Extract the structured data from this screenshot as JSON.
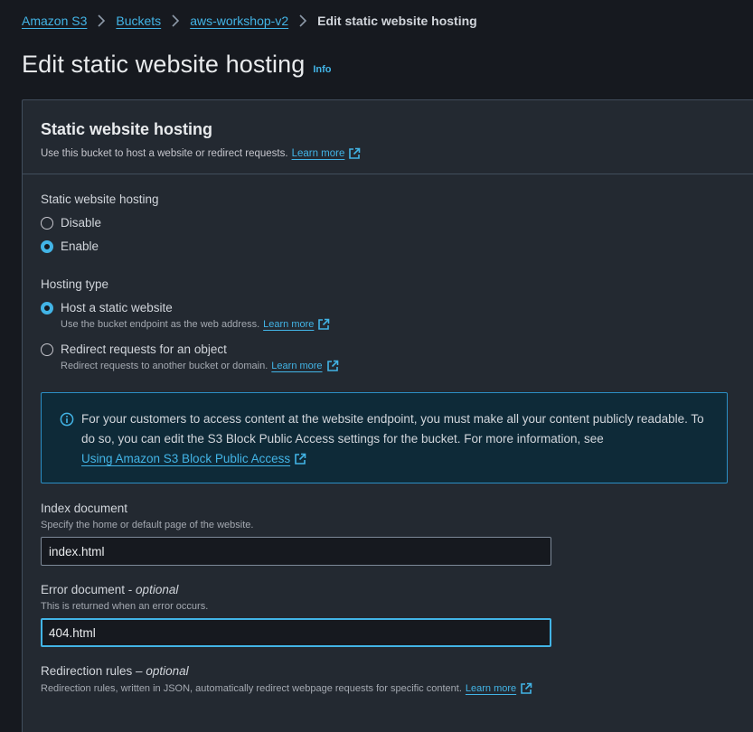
{
  "breadcrumb": {
    "items": [
      "Amazon S3",
      "Buckets",
      "aws-workshop-v2"
    ],
    "current": "Edit static website hosting"
  },
  "page": {
    "title": "Edit static website hosting",
    "info_label": "Info"
  },
  "panel": {
    "title": "Static website hosting",
    "description": "Use this bucket to host a website or redirect requests.",
    "learn_more": "Learn more"
  },
  "hosting": {
    "label": "Static website hosting",
    "options": [
      "Disable",
      "Enable"
    ],
    "selected": "Enable"
  },
  "hosting_type": {
    "label": "Hosting type",
    "options": [
      {
        "label": "Host a static website",
        "hint": "Use the bucket endpoint as the web address.",
        "link": "Learn more"
      },
      {
        "label": "Redirect requests for an object",
        "hint": "Redirect requests to another bucket or domain.",
        "link": "Learn more"
      }
    ],
    "selected": "Host a static website"
  },
  "alert": {
    "text": "For your customers to access content at the website endpoint, you must make all your content publicly readable. To do so, you can edit the S3 Block Public Access settings for the bucket. For more information, see",
    "link": "Using Amazon S3 Block Public Access"
  },
  "index_document": {
    "label": "Index document",
    "hint": "Specify the home or default page of the website.",
    "value": "index.html"
  },
  "error_document": {
    "label": "Error document",
    "label_suffix": "optional",
    "hint": "This is returned when an error occurs.",
    "value": "404.html"
  },
  "redirection_rules": {
    "label": "Redirection rules",
    "label_suffix": "optional",
    "hint": "Redirection rules, written in JSON, automatically redirect webpage requests for specific content.",
    "link": "Learn more"
  },
  "colors": {
    "background": "#16191f",
    "panel": "#232931",
    "accent": "#42b4e6",
    "alert_bg": "#0e2a38"
  }
}
